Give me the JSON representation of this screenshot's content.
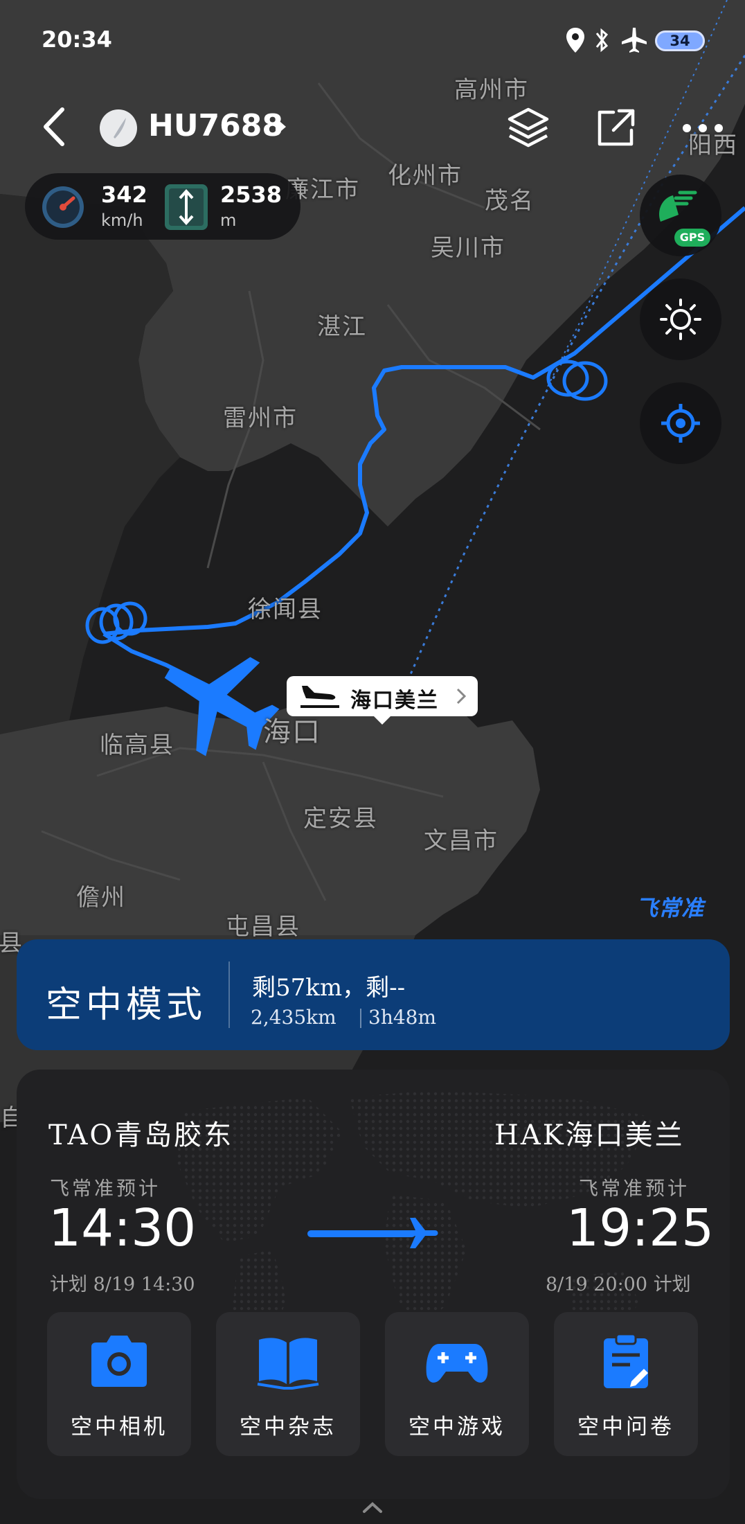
{
  "status_bar": {
    "time": "20:34",
    "battery": "34"
  },
  "header": {
    "flight_number": "HU7688"
  },
  "stats": {
    "speed_value": "342",
    "speed_unit": "km/h",
    "altitude_value": "2538",
    "altitude_unit": "m"
  },
  "gps_badge": "GPS",
  "map": {
    "labels": [
      {
        "text": "高州市"
      },
      {
        "text": "阳西"
      },
      {
        "text": "廉江市"
      },
      {
        "text": "化州市"
      },
      {
        "text": "茂名"
      },
      {
        "text": "吴川市"
      },
      {
        "text": "湛江"
      },
      {
        "text": "雷州市"
      },
      {
        "text": "徐闻县"
      },
      {
        "text": "临高县"
      },
      {
        "text": "海口"
      },
      {
        "text": "定安县"
      },
      {
        "text": "文昌市"
      },
      {
        "text": "儋州"
      },
      {
        "text": "屯昌县"
      },
      {
        "text": "台县"
      },
      {
        "text": "自"
      }
    ],
    "destination_bubble": "海口美兰",
    "brand": "飞常准"
  },
  "air_mode": {
    "title": "空中模式",
    "remaining": "剩57km，剩--",
    "distance": "2,435km",
    "duration": "3h48m"
  },
  "flight": {
    "origin": {
      "code_name": "TAO青岛胶东",
      "est_label": "飞常准预计",
      "time": "14:30",
      "plan": "计划 8/19 14:30"
    },
    "destination": {
      "code_name": "HAK海口美兰",
      "est_label": "飞常准预计",
      "time": "19:25",
      "plan": "8/19 20:00 计划"
    }
  },
  "tiles": [
    {
      "label": "空中相机",
      "icon": "camera-icon"
    },
    {
      "label": "空中杂志",
      "icon": "book-icon"
    },
    {
      "label": "空中游戏",
      "icon": "gamepad-icon"
    },
    {
      "label": "空中问卷",
      "icon": "clipboard-icon"
    }
  ],
  "colors": {
    "accent": "#1b7bff",
    "air_mode_bg": "#0c3d78",
    "card_bg": "#212123",
    "tile_bg": "#2c2c2f"
  }
}
